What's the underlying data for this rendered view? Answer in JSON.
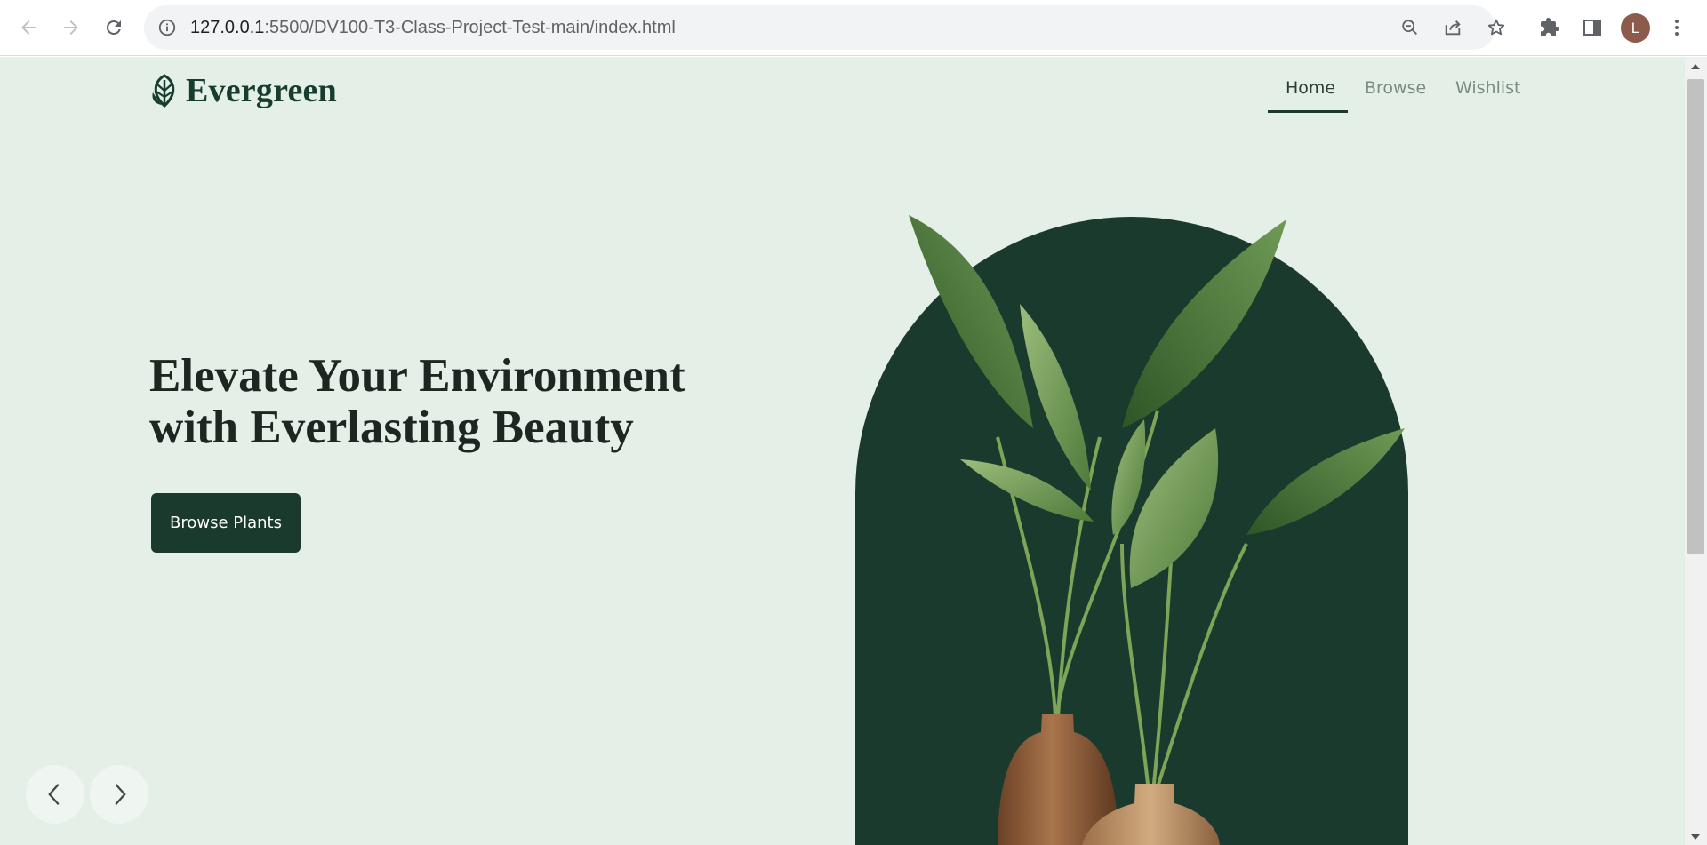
{
  "browser": {
    "url_host": "127.0.0.1",
    "url_path": ":5500/DV100-T3-Class-Project-Test-main/index.html",
    "profile_initial": "L"
  },
  "site": {
    "brand": "Evergreen",
    "nav": [
      {
        "label": "Home",
        "active": true
      },
      {
        "label": "Browse",
        "active": false
      },
      {
        "label": "Wishlist",
        "active": false
      }
    ]
  },
  "hero": {
    "title_line1": "Elevate Your Environment",
    "title_line2": "with Everlasting Beauty",
    "cta_label": "Browse Plants"
  },
  "colors": {
    "page_bg": "#e4efe7",
    "brand_dark": "#193a2d",
    "arch": "#1b3a2e"
  },
  "icons": [
    "back-icon",
    "forward-icon",
    "reload-icon",
    "info-icon",
    "zoom-out-icon",
    "share-icon",
    "star-icon",
    "extensions-icon",
    "side-panel-icon",
    "more-icon",
    "leaf-logo-icon",
    "chevron-left-icon",
    "chevron-right-icon"
  ]
}
